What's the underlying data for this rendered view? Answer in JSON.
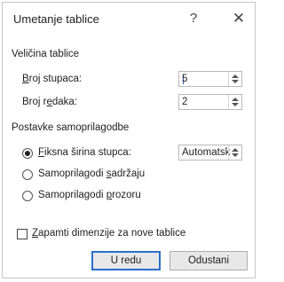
{
  "dialog": {
    "title": "Umetanje tablice",
    "help_glyph": "?",
    "close_glyph": "✕"
  },
  "size_group": {
    "label": "Veličina tablice",
    "columns": {
      "label_pre": "",
      "label_accel": "B",
      "label_post": "roj stupaca:",
      "value": "5"
    },
    "rows": {
      "label_pre": "Broj r",
      "label_accel": "e",
      "label_post": "daka:",
      "value": "2"
    }
  },
  "autofit_group": {
    "label": "Postavke samoprilagodbe",
    "options": [
      {
        "pre": "",
        "accel": "F",
        "post": "iksna širina stupca:",
        "checked": true
      },
      {
        "pre": "Samoprilagodi ",
        "accel": "s",
        "post": "adržaju",
        "checked": false
      },
      {
        "pre": "Samoprilagodi ",
        "accel": "p",
        "post": "rozoru",
        "checked": false
      }
    ],
    "fixed_width_value": "Automatsk"
  },
  "remember": {
    "pre": "",
    "accel": "Z",
    "post": "apamti dimenzije za nove tablice",
    "checked": false
  },
  "buttons": {
    "ok": "U redu",
    "cancel": "Odustani"
  },
  "colors": {
    "primary_border": "#2b6fc9",
    "cursor": "#2a5db0"
  },
  "icons": {
    "help": "help-icon",
    "close": "close-icon",
    "spin_up": "arrow-up-icon",
    "spin_down": "arrow-down-icon"
  }
}
